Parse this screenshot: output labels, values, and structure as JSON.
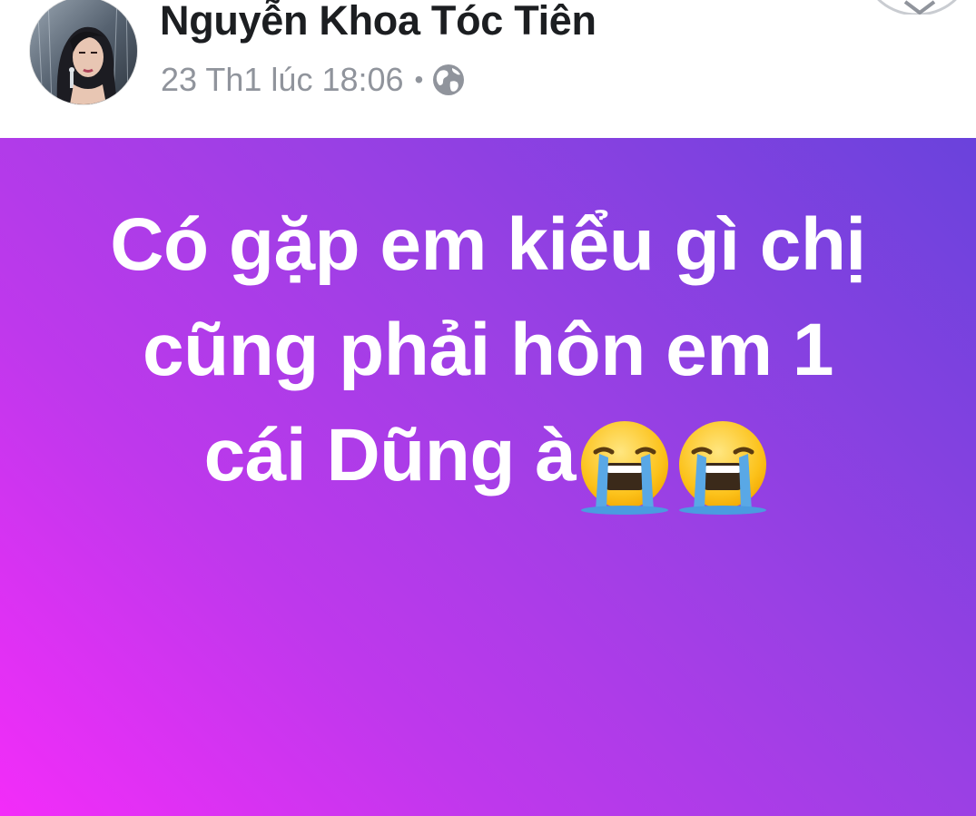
{
  "post": {
    "author_name": "Nguyễn Khoa Tóc Tiên",
    "timestamp": "23 Th1 lúc 18:06",
    "separator": "•",
    "privacy_icon": "globe-icon",
    "avatar_icon": "profile-photo",
    "menu_icon": "chevron-down-icon",
    "background": {
      "gradient_from": "#f32cf9",
      "gradient_to": "#6a42dc"
    },
    "text": {
      "line1": "Có gặp em kiểu gì chị",
      "line2": "cũng phải hôn em 1",
      "line3": "cái Dũng à"
    },
    "emojis": [
      "loudly-crying-face-emoji",
      "loudly-crying-face-emoji"
    ]
  }
}
